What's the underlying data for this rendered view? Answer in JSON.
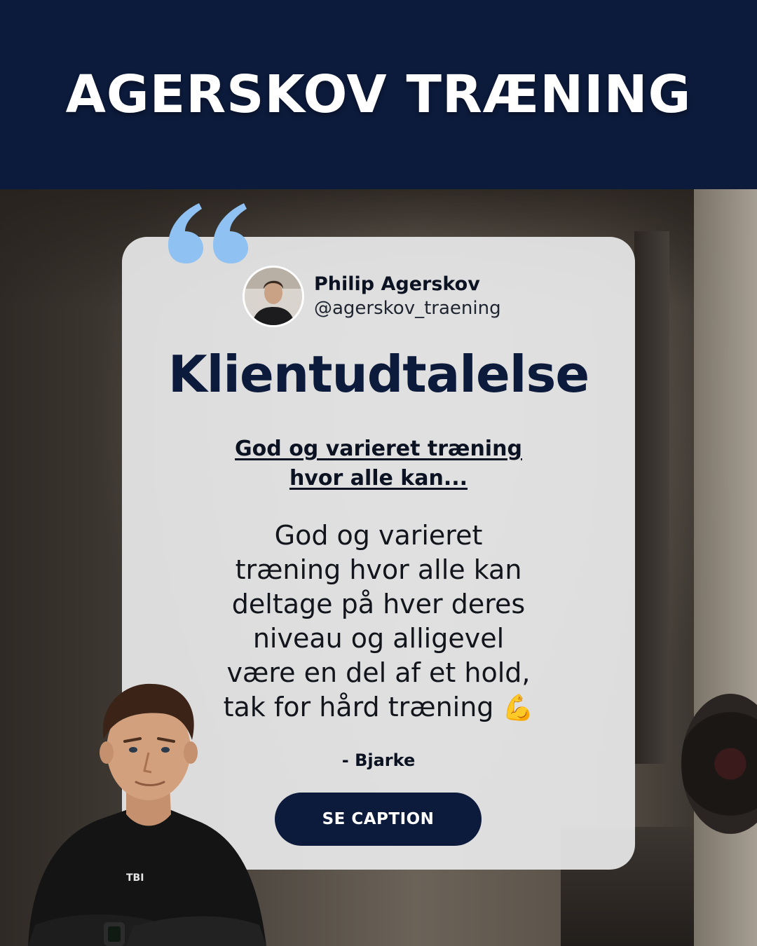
{
  "banner": {
    "title": "AGERSKOV TRÆNING"
  },
  "colors": {
    "navy": "#0c1a3b",
    "quote_accent": "#8fc1f2",
    "card_bg": "#e8e8ea"
  },
  "card": {
    "profile": {
      "name": "Philip Agerskov",
      "handle": "@agerskov_traening"
    },
    "title": "Klientudtalelse",
    "subtitle_lines": [
      "God og varieret træning",
      "hvor alle kan..."
    ],
    "quote_lines": [
      "God og varieret",
      "træning hvor alle kan",
      "deltage på hver deres",
      "niveau og alligevel",
      "være en del af et hold,",
      "tak for hård træning"
    ],
    "quote_emoji": "💪",
    "author": "- Bjarke",
    "cta_label": "SE CAPTION"
  },
  "person_shirt_text": "TBI",
  "icons": {
    "quote": "quote-marks-icon",
    "emoji": "flexed-biceps-icon"
  }
}
